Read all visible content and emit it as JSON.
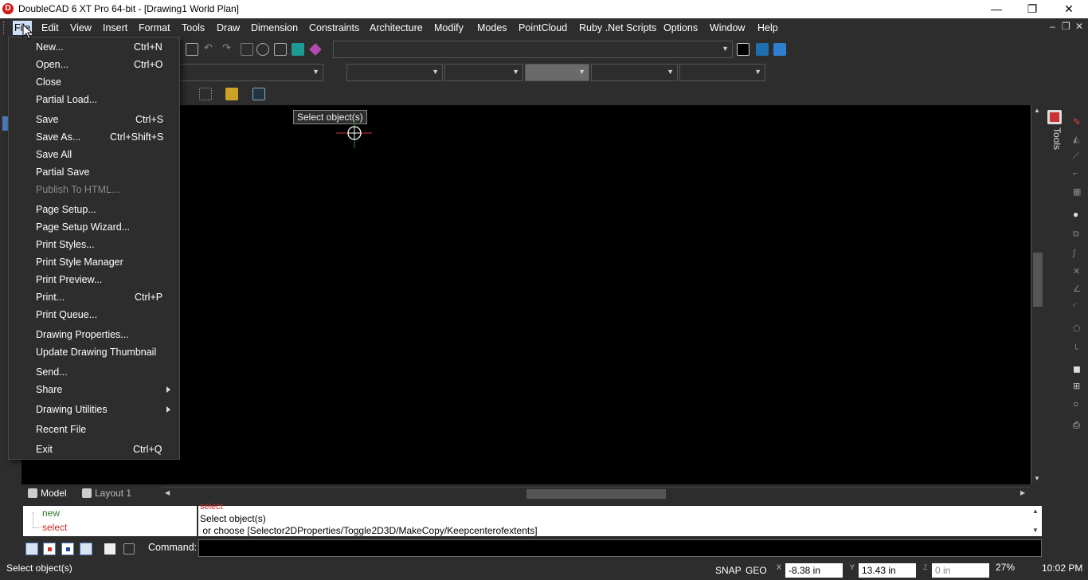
{
  "window": {
    "title": "DoubleCAD 6 XT Pro 64-bit - [Drawing1 World Plan]",
    "logo_letter": "D",
    "controls": {
      "minimize": "—",
      "restore": "❐",
      "close": "✕"
    }
  },
  "menubar": {
    "items": [
      "File",
      "Edit",
      "View",
      "Insert",
      "Format",
      "Tools",
      "Draw",
      "Dimension",
      "Constraints",
      "Architecture",
      "Modify",
      "Modes",
      "PointCloud",
      "Ruby .Net Scripts",
      "Options",
      "Window",
      "Help"
    ],
    "active": "File",
    "mdi_controls": [
      "–",
      "❐",
      "✕"
    ]
  },
  "file_menu": {
    "items": [
      {
        "label": "New...",
        "shortcut": "Ctrl+N"
      },
      {
        "label": "Open...",
        "shortcut": "Ctrl+O"
      },
      {
        "label": "Close",
        "shortcut": ""
      },
      {
        "label": "Partial Load...",
        "shortcut": ""
      },
      {
        "label": "Save",
        "shortcut": "Ctrl+S"
      },
      {
        "label": "Save As...",
        "shortcut": "Ctrl+Shift+S"
      },
      {
        "label": "Save All",
        "shortcut": ""
      },
      {
        "label": "Partial Save",
        "shortcut": ""
      },
      {
        "label": "Publish To HTML...",
        "shortcut": "",
        "disabled": true
      },
      {
        "label": "Page Setup...",
        "shortcut": ""
      },
      {
        "label": "Page Setup Wizard...",
        "shortcut": ""
      },
      {
        "label": "Print Styles...",
        "shortcut": ""
      },
      {
        "label": "Print Style Manager",
        "shortcut": ""
      },
      {
        "label": "Print Preview...",
        "shortcut": ""
      },
      {
        "label": "Print...",
        "shortcut": "Ctrl+P"
      },
      {
        "label": "Print Queue...",
        "shortcut": ""
      },
      {
        "label": "Drawing Properties...",
        "shortcut": ""
      },
      {
        "label": "Update Drawing Thumbnail",
        "shortcut": ""
      },
      {
        "label": "Send...",
        "shortcut": ""
      },
      {
        "label": "Share",
        "shortcut": "",
        "submenu": true
      },
      {
        "label": "Drawing Utilities",
        "shortcut": "",
        "submenu": true
      },
      {
        "label": "Recent File",
        "shortcut": ""
      },
      {
        "label": "Exit",
        "shortcut": "Ctrl+Q"
      }
    ]
  },
  "canvas": {
    "tooltip": "Select object(s)",
    "cursor_icon": "crosshair-cursor-icon"
  },
  "right_panel": {
    "tools_label": "Tools"
  },
  "tabs": [
    {
      "label": "Model"
    },
    {
      "label": "Layout 1"
    }
  ],
  "command": {
    "tree": [
      "new",
      "select"
    ],
    "history_lines": [
      "select",
      "Select object(s)",
      " or choose [Selector2DProperties/Toggle2D3D/MakeCopy/Keepcenterofextents]"
    ],
    "prompt_label": "Command:",
    "input_value": ""
  },
  "status": {
    "message": "Select object(s)",
    "snap": "SNAP",
    "geo": "GEO",
    "x_label": "X",
    "x_value": "-8.38 in",
    "y_label": "Y",
    "y_value": "13.43 in",
    "z_label": "Z",
    "z_value": "0 in",
    "zoom": "27%",
    "time": "10:02 PM"
  },
  "colors": {
    "background": "#2d2d2d",
    "canvas": "#000000",
    "menu_active": "#cfe1f7",
    "tree_new": "#2e7d32",
    "tree_select": "#c62828",
    "history_select": "#c62828"
  }
}
